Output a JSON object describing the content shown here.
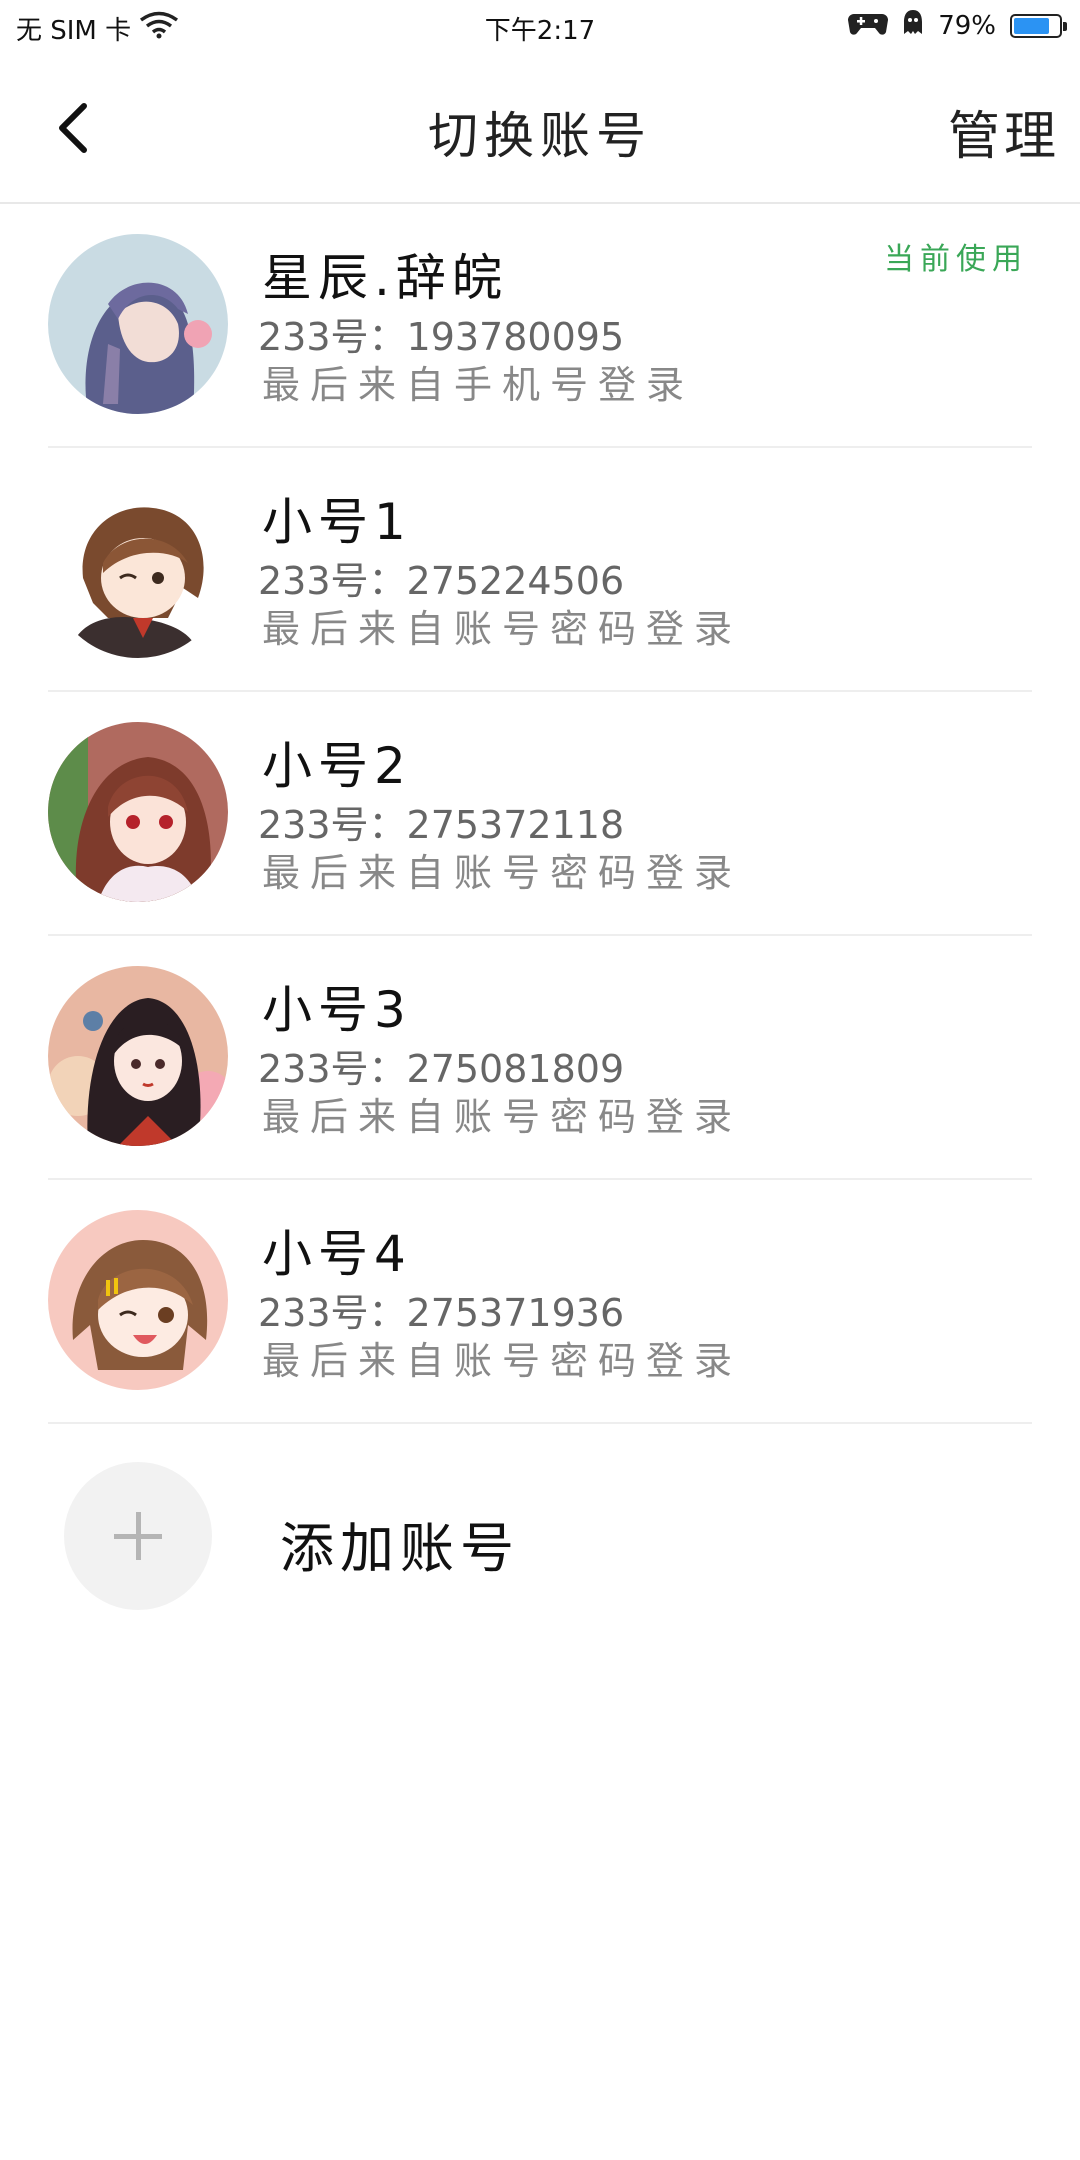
{
  "status_bar": {
    "carrier": "无 SIM 卡",
    "time": "下午2:17",
    "battery_text": "79%",
    "battery_level": 0.79,
    "icons": [
      "wifi-icon",
      "game-controller-icon",
      "ghost-icon",
      "battery-icon"
    ]
  },
  "header": {
    "title": "切换账号",
    "manage_label": "管理",
    "back_icon": "chevron-left-icon"
  },
  "accounts": [
    {
      "name": "星辰.辞皖",
      "id_text": "233号：193780095",
      "login_text": "最后来自手机号登录",
      "badge": "当前使用"
    },
    {
      "name": "小号1",
      "id_text": "233号：275224506",
      "login_text": "最后来自账号密码登录",
      "badge": ""
    },
    {
      "name": "小号2",
      "id_text": "233号：275372118",
      "login_text": "最后来自账号密码登录",
      "badge": ""
    },
    {
      "name": "小号3",
      "id_text": "233号：275081809",
      "login_text": "最后来自账号密码登录",
      "badge": ""
    },
    {
      "name": "小号4",
      "id_text": "233号：275371936",
      "login_text": "最后来自账号密码登录",
      "badge": ""
    }
  ],
  "add_account": {
    "label": "添加账号",
    "icon": "plus-icon"
  },
  "colors": {
    "accent_green": "#3aa757",
    "battery_blue": "#2b93f3",
    "divider": "#eeeeee"
  }
}
